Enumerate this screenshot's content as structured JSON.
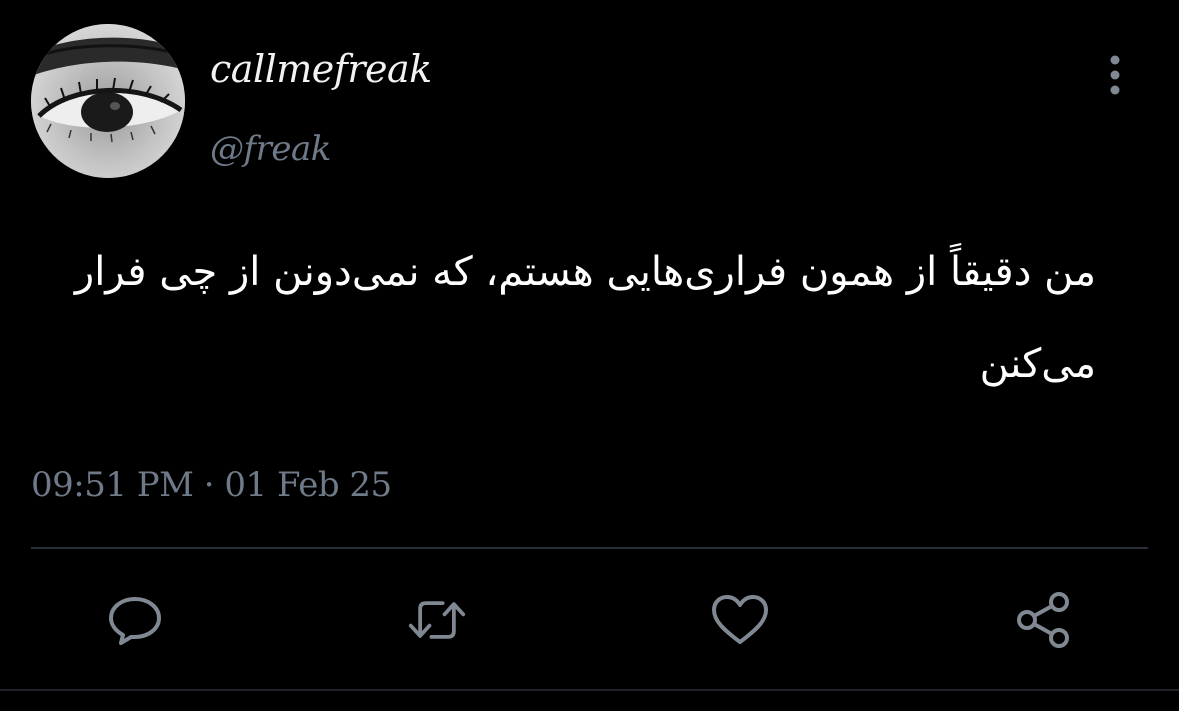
{
  "tweet": {
    "author": {
      "display_name": "callmefreak",
      "handle": "@freak",
      "avatar_icon": "eye-avatar"
    },
    "text": "من دقیقاً از همون فراری‌هایی هستم، که نمی‌دونن از چی فرار می‌کنن",
    "timestamp": "09:51 PM · 01 Feb 25"
  },
  "icons": {
    "more": "more-vertical-icon",
    "reply": "comment-icon",
    "retweet": "retweet-icon",
    "like": "heart-icon",
    "share": "share-icon"
  },
  "colors": {
    "background": "#000000",
    "text_primary": "#ffffff",
    "text_secondary": "#6f7a88",
    "icon": "#7f8893",
    "divider": "#2a2f36"
  }
}
